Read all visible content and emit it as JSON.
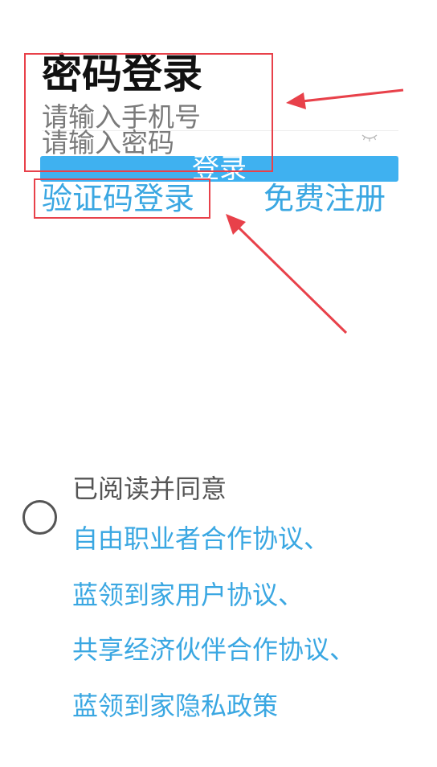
{
  "login": {
    "title": "密码登录",
    "phone_placeholder": "请输入手机号",
    "password_placeholder": "请输入密码",
    "eye_icon": "eye-closed-icon",
    "login_button": "登录",
    "sms_login_link": "验证码登录",
    "register_link": "免费注册"
  },
  "agreement": {
    "prompt": "已阅读并同意",
    "radio_checked": false,
    "links": [
      "自由职业者合作协议、",
      "蓝领到家用户协议、",
      "共享经济伙伴合作协议、",
      "蓝领到家隐私政策"
    ]
  },
  "colors": {
    "accent": "#3fb1f0",
    "link": "#3aa7e2",
    "annotation": "#e8414a",
    "title": "#111111"
  }
}
